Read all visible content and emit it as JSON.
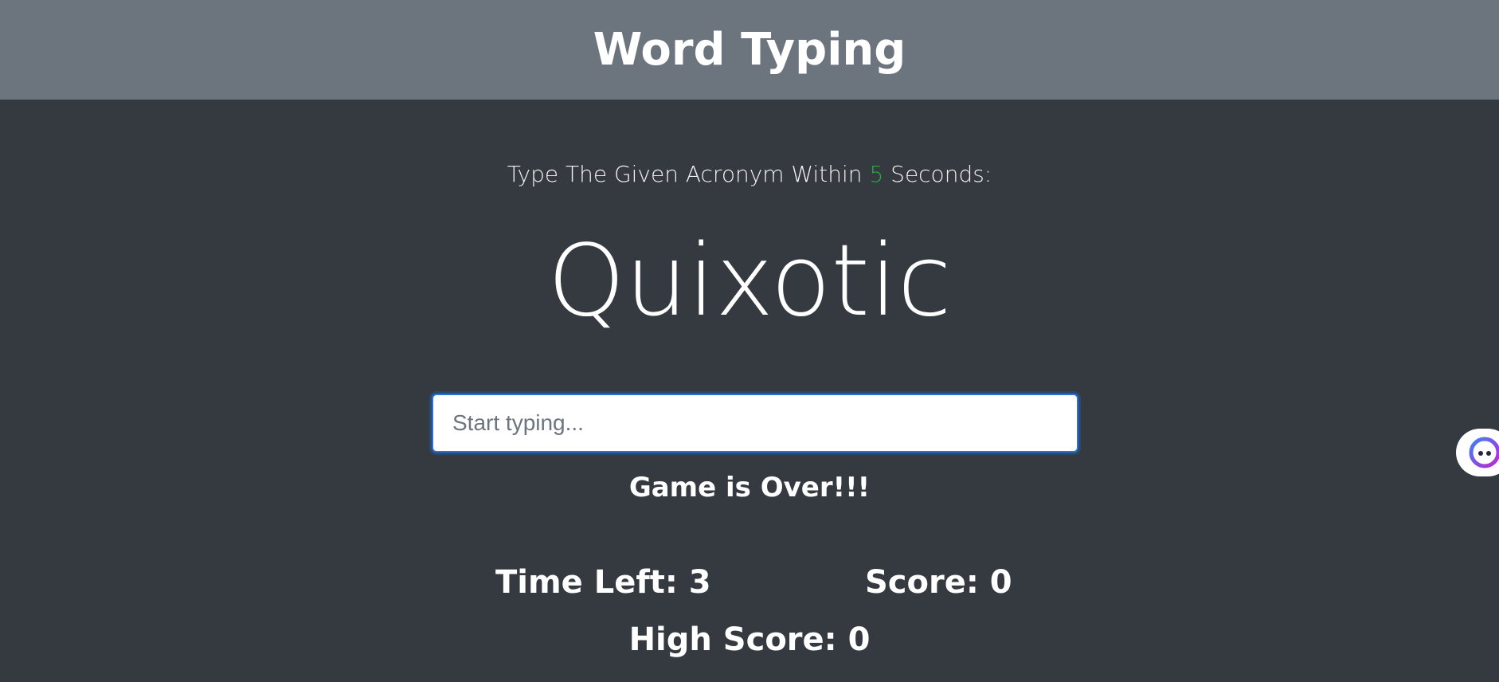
{
  "header": {
    "title": "Word Typing"
  },
  "prompt": {
    "prefix": "Type The Given Acronym Within ",
    "seconds": "5",
    "suffix": " Seconds:"
  },
  "current_word": "Quixotic",
  "input": {
    "placeholder": "Start typing...",
    "value": ""
  },
  "status_message": "Game is Over!!!",
  "stats": {
    "time_left_label": "Time Left: ",
    "time_left": "3",
    "score_label": "Score: ",
    "score": "0",
    "high_score_label": "High Score: ",
    "high_score": "0"
  },
  "colors": {
    "header_bg": "#6c757d",
    "body_bg": "#343a40",
    "seconds_accent": "#28a745",
    "input_focus": "#2f6fd6"
  },
  "icons": {
    "side_widget": "assistant-face-icon"
  }
}
